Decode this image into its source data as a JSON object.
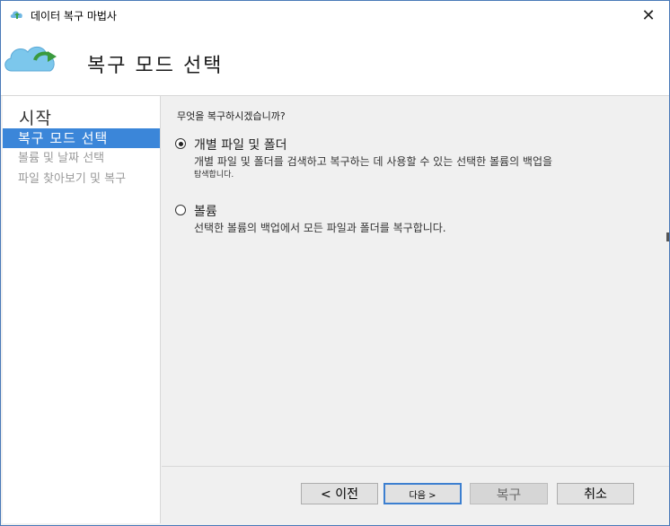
{
  "window": {
    "title": "데이터 복구 마법사",
    "close_glyph": "✕"
  },
  "header": {
    "title": "복구 모드 선택"
  },
  "nav": {
    "start_label": "시작",
    "items": [
      {
        "label": "복구 모드 선택",
        "state": "active"
      },
      {
        "label": "볼륨 및 날짜 선택",
        "state": "disabled"
      },
      {
        "label": "파일 찾아보기 및 복구",
        "state": "disabled"
      }
    ]
  },
  "content": {
    "question": "무엇을 복구하시겠습니까?",
    "options": [
      {
        "label": "개별 파일 및 폴더",
        "description": "개별 파일 및 폴더를 검색하고 복구하는 데 사용할 수 있는 선택한 볼륨의 백업을",
        "description2": "탐색합니다.",
        "selected": true
      },
      {
        "label": "볼륨",
        "description": "선택한 볼륨의 백업에서 모든 파일과 폴더를 복구합니다.",
        "description2": "",
        "selected": false
      }
    ]
  },
  "buttons": {
    "prev": "< 이전",
    "next": "다음 >",
    "recover": "복구",
    "cancel": "취소"
  },
  "colors": {
    "accent": "#3b86d9",
    "window_border": "#4a7ab8"
  }
}
